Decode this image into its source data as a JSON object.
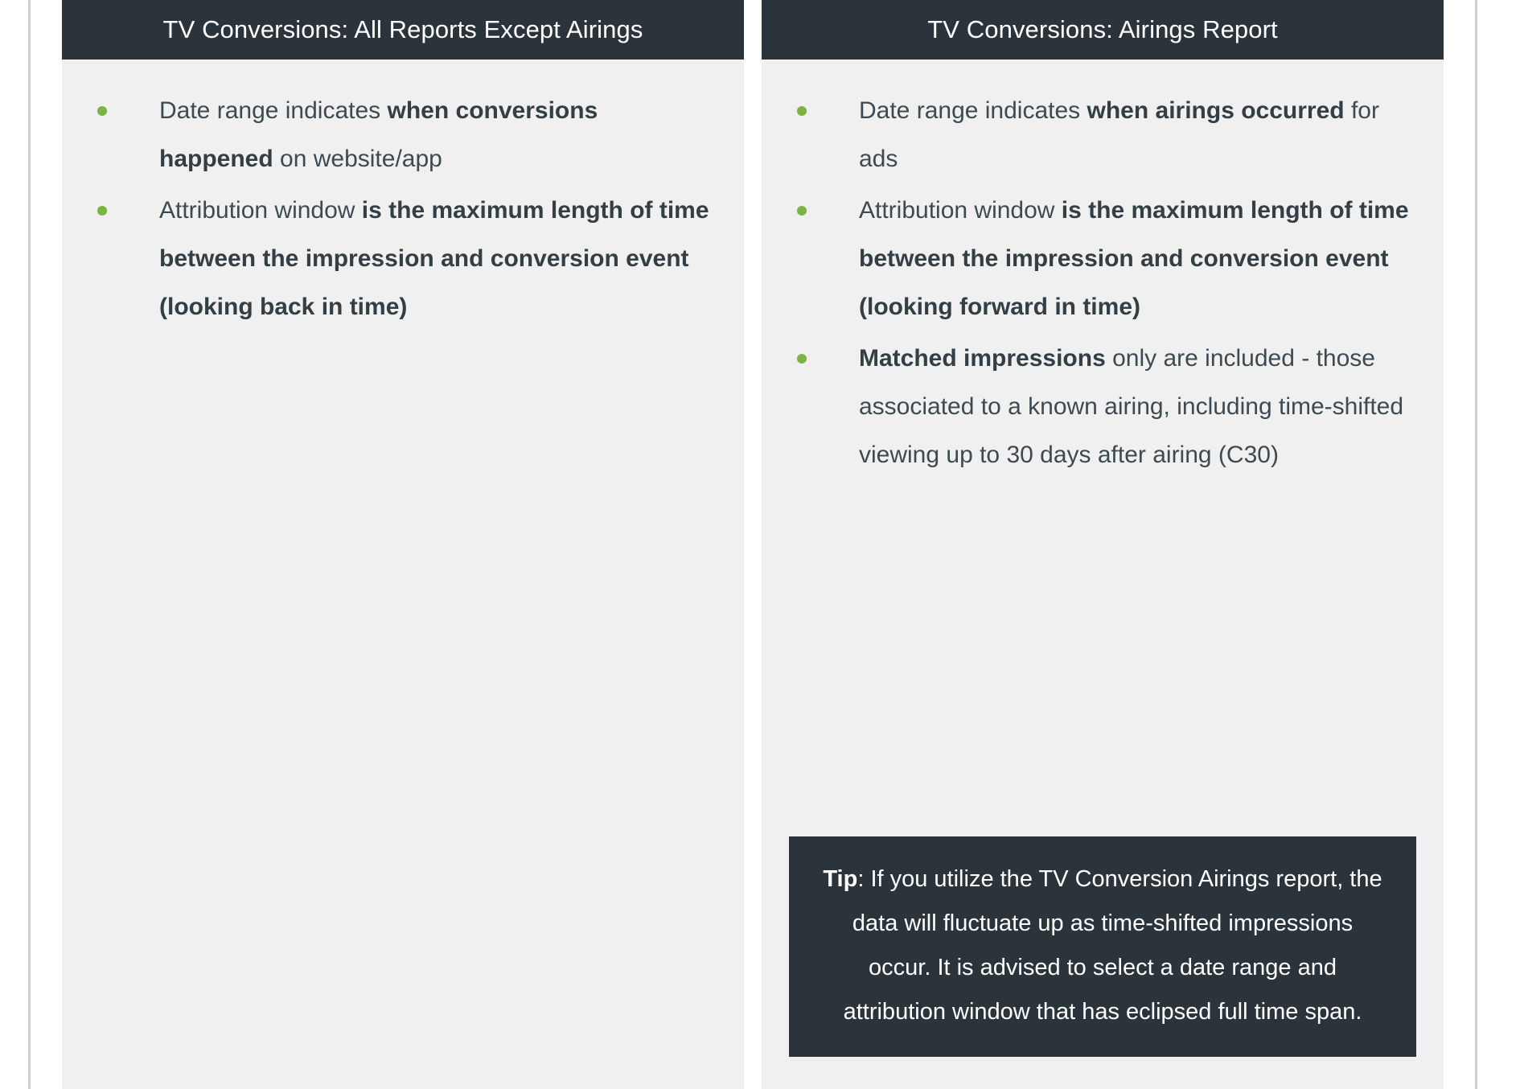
{
  "colors": {
    "header_bg": "#2b343a",
    "card_bg": "#f0f0f0",
    "bullet_green": "#7cb342",
    "body_text": "#3d4a52",
    "tip_bg": "#2b343a",
    "rule": "#cfd0d2"
  },
  "cards": [
    {
      "id": "all-reports-except-airings",
      "title": "TV Conversions: All Reports Except Airings",
      "bullets": [
        {
          "parts": [
            {
              "text": "Date range indicates ",
              "bold": false
            },
            {
              "text": "when conversions happened",
              "bold": true
            },
            {
              "text": " on website/app",
              "bold": false
            }
          ]
        },
        {
          "parts": [
            {
              "text": "Attribution window ",
              "bold": false
            },
            {
              "text": "is the maximum length of time between the impression and conversion event (looking back in time)",
              "bold": true
            }
          ]
        }
      ],
      "tip": null
    },
    {
      "id": "airings-report",
      "title": "TV Conversions: Airings Report",
      "bullets": [
        {
          "parts": [
            {
              "text": "Date range indicates ",
              "bold": false
            },
            {
              "text": "when airings occurred",
              "bold": true
            },
            {
              "text": " for ads",
              "bold": false
            }
          ]
        },
        {
          "parts": [
            {
              "text": "Attribution window ",
              "bold": false
            },
            {
              "text": "is the maximum length of time between the impression and conversion event (looking forward in time)",
              "bold": true
            }
          ]
        },
        {
          "parts": [
            {
              "text": "Matched impressions",
              "bold": true
            },
            {
              "text": " only are included - those associated to a known airing, including time-shifted viewing up to 30 days after airing (C30)",
              "bold": false
            }
          ]
        }
      ],
      "tip": {
        "parts": [
          {
            "text": "Tip",
            "bold": true
          },
          {
            "text": ": If you utilize the TV Conversion Airings report, the data will fluctuate up as time-shifted impressions occur. It is advised to select a date range and attribution window that has eclipsed full time span.",
            "bold": false
          }
        ]
      }
    }
  ]
}
